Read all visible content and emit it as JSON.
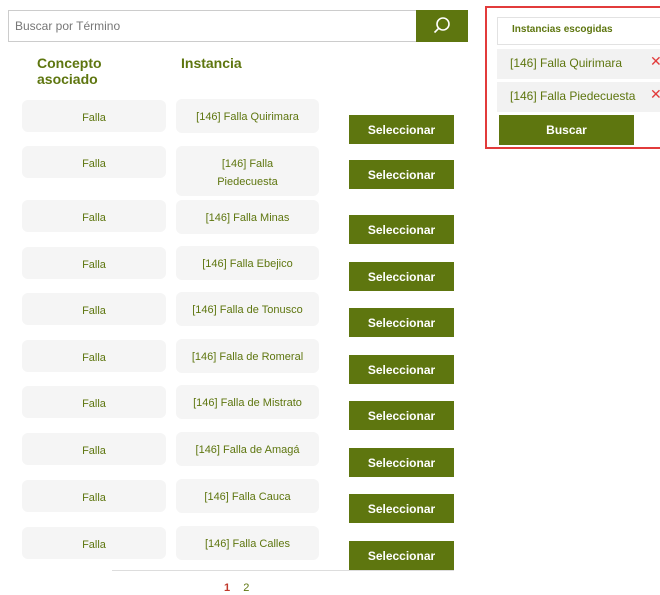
{
  "search": {
    "placeholder": "Buscar por Término",
    "value": ""
  },
  "columns": {
    "concepto": "Concepto asociado",
    "instancia": "Instancia"
  },
  "rows": [
    {
      "concepto": "Falla",
      "instancia": "[146] Falla Quirimara",
      "action": "Seleccionar"
    },
    {
      "concepto": "Falla",
      "instancia": "[146] Falla Piedecuesta",
      "action": "Seleccionar"
    },
    {
      "concepto": "Falla",
      "instancia": "[146] Falla Minas",
      "action": "Seleccionar"
    },
    {
      "concepto": "Falla",
      "instancia": "[146] Falla Ebejico",
      "action": "Seleccionar"
    },
    {
      "concepto": "Falla",
      "instancia": "[146] Falla de Tonusco",
      "action": "Seleccionar"
    },
    {
      "concepto": "Falla",
      "instancia": "[146] Falla de Romeral",
      "action": "Seleccionar"
    },
    {
      "concepto": "Falla",
      "instancia": "[146] Falla de Mistrato",
      "action": "Seleccionar"
    },
    {
      "concepto": "Falla",
      "instancia": "[146] Falla de Amagá",
      "action": "Seleccionar"
    },
    {
      "concepto": "Falla",
      "instancia": "[146] Falla Cauca",
      "action": "Seleccionar"
    },
    {
      "concepto": "Falla",
      "instancia": "[146] Falla Calles",
      "action": "Seleccionar"
    }
  ],
  "pagination": {
    "pages": [
      "1",
      "2"
    ],
    "current": "1"
  },
  "selected_panel": {
    "title": "Instancias escogidas",
    "items": [
      "[146] Falla Quirimara",
      "[146] Falla Piedecuesta"
    ],
    "remove_symbol": "✕",
    "search_button": "Buscar"
  },
  "colors": {
    "brand_green": "#5e760f",
    "highlight_red": "#e23b3b",
    "cell_bg": "#f5f5f5"
  },
  "icons": {
    "search_button": "search-icon",
    "remove": "close-icon"
  }
}
